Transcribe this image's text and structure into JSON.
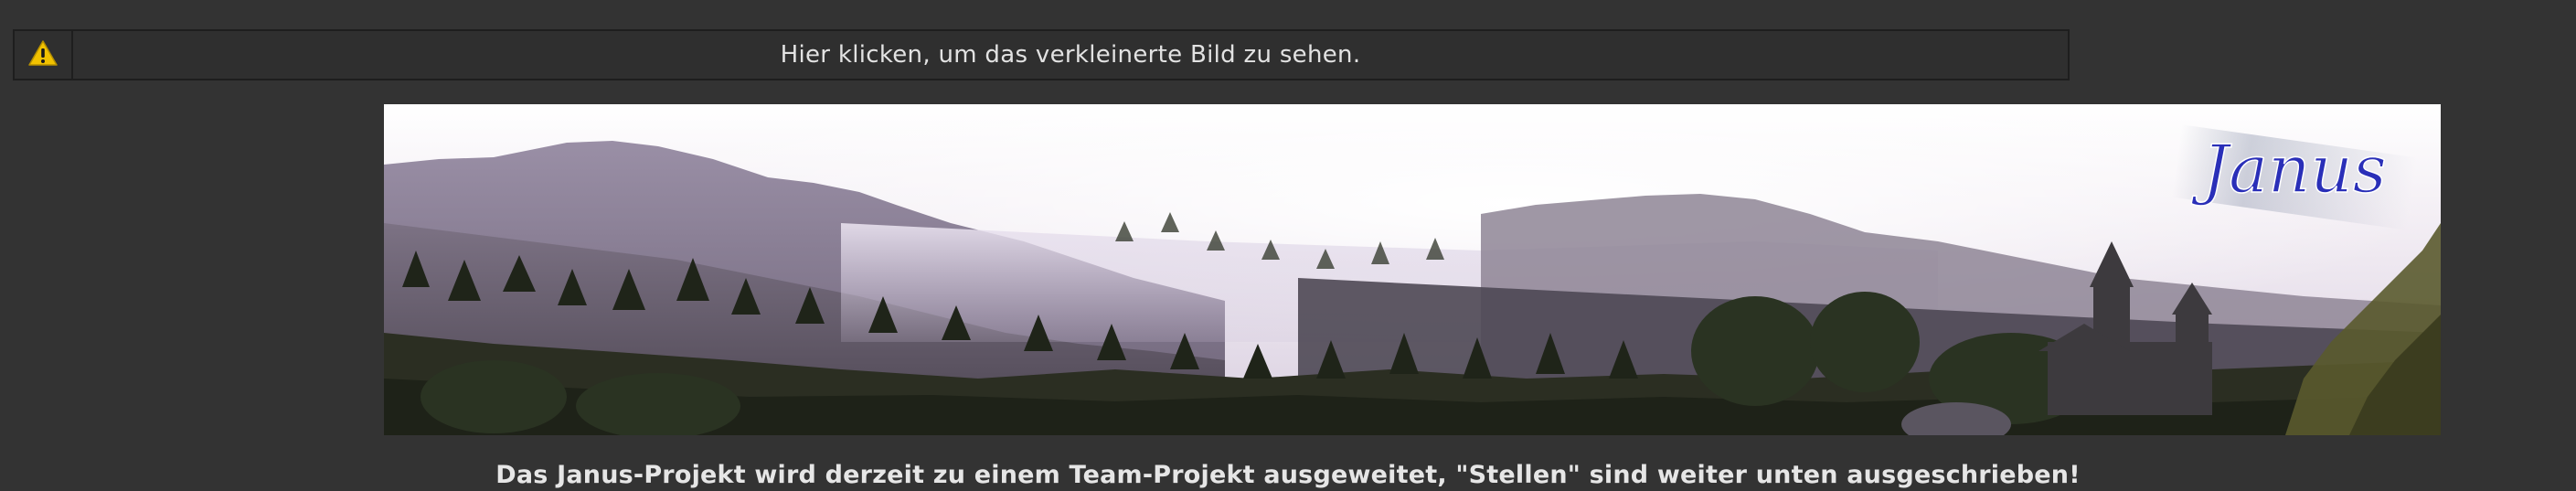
{
  "notice": {
    "text": "Hier klicken, um das verkleinerte Bild zu sehen.",
    "icon": "warning-icon"
  },
  "banner": {
    "logo_text": "Janus"
  },
  "announcement": {
    "text": "Das Janus-Projekt wird derzeit zu einem Team-Projekt ausgeweitet, \"Stellen\" sind weiter unten ausgeschrieben!"
  },
  "colors": {
    "background": "#333333",
    "warning_yellow": "#f2c200",
    "logo_blue": "#2a2fb8"
  }
}
